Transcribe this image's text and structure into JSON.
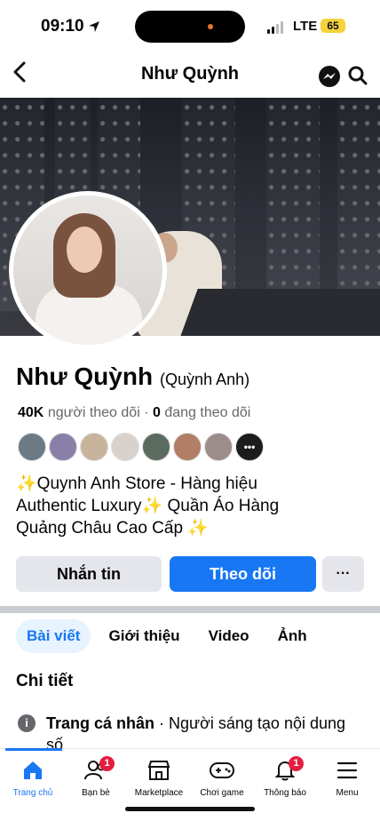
{
  "status": {
    "time": "09:10",
    "network": "LTE",
    "battery": "65"
  },
  "nav": {
    "title": "Như Quỳnh",
    "icons": [
      "back-arrow",
      "messenger-icon",
      "search-icon"
    ]
  },
  "profile": {
    "name": "Như Quỳnh",
    "alt_name": "(Quỳnh Anh)",
    "followers_count": "40K",
    "followers_label": "người theo dõi",
    "separator": " · ",
    "following_count": "0",
    "following_label": "đang theo dõi",
    "bio_line1": "Quynh Anh Store - Hàng hiệu",
    "bio_line2": "Authentic Luxury",
    "bio_line2b": " Quần Áo Hàng",
    "bio_line3": "Quảng Châu Cao Cấp",
    "sparkle": "✨"
  },
  "buttons": {
    "message": "Nhắn tin",
    "follow": "Theo dõi",
    "more": "···"
  },
  "tabs": [
    "Bài viết",
    "Giới thiệu",
    "Video",
    "Ảnh"
  ],
  "section_title": "Chi tiết",
  "detail": {
    "bold": "Trang cá nhân",
    "rest": " · Người sáng tạo nội dung số"
  },
  "bottom_nav": [
    {
      "label": "Trang chủ",
      "icon": "home-icon",
      "badge": ""
    },
    {
      "label": "Bạn bè",
      "icon": "friends-icon",
      "badge": "1"
    },
    {
      "label": "Marketplace",
      "icon": "marketplace-icon",
      "badge": ""
    },
    {
      "label": "Chơi game",
      "icon": "gaming-icon",
      "badge": ""
    },
    {
      "label": "Thông báo",
      "icon": "bell-icon",
      "badge": "1"
    },
    {
      "label": "Menu",
      "icon": "menu-icon",
      "badge": ""
    }
  ],
  "colors": {
    "accent": "#1877f2",
    "badge": "#e41e3f",
    "tab_active_bg": "#e7f3ff"
  }
}
